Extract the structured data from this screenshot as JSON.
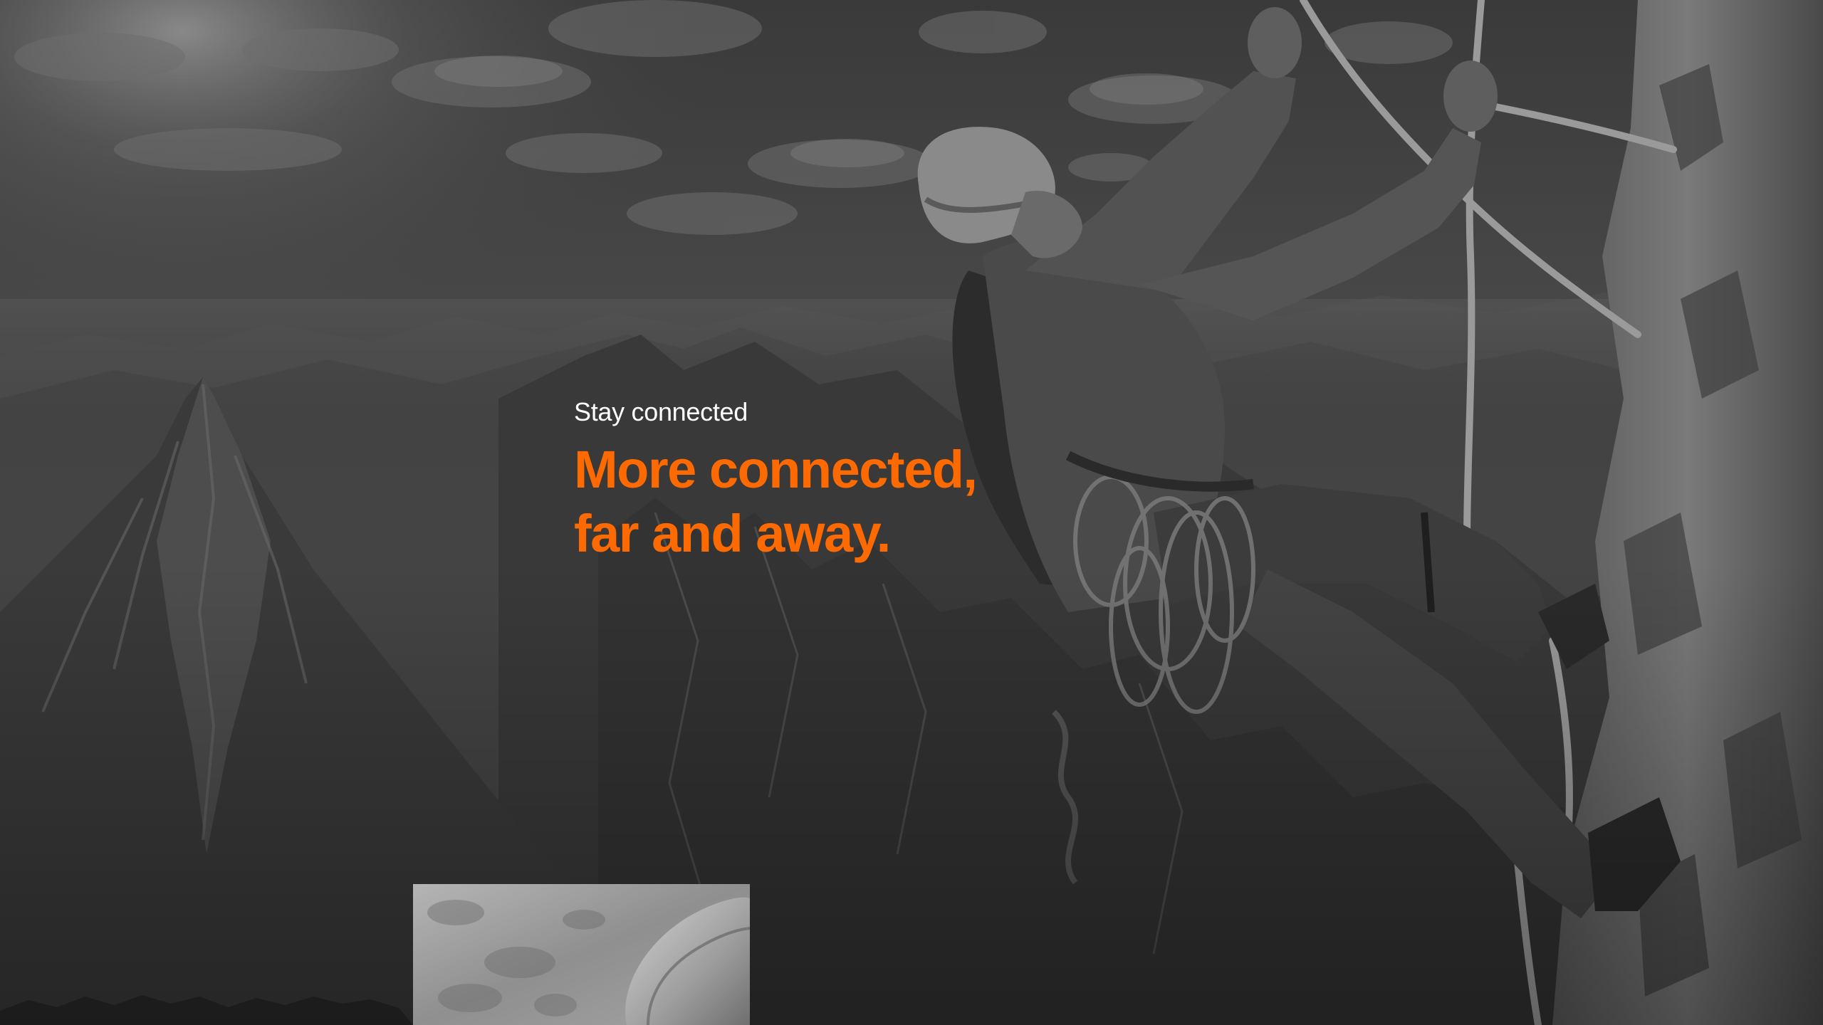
{
  "hero": {
    "eyebrow": "Stay connected",
    "headline_line1": "More connected,",
    "headline_line2": "far and away.",
    "accent_color": "#ff6a00",
    "eyebrow_color": "#ffffff"
  },
  "images": {
    "background": "mountain-climber-photo",
    "inset": "rock-texture-photo"
  }
}
